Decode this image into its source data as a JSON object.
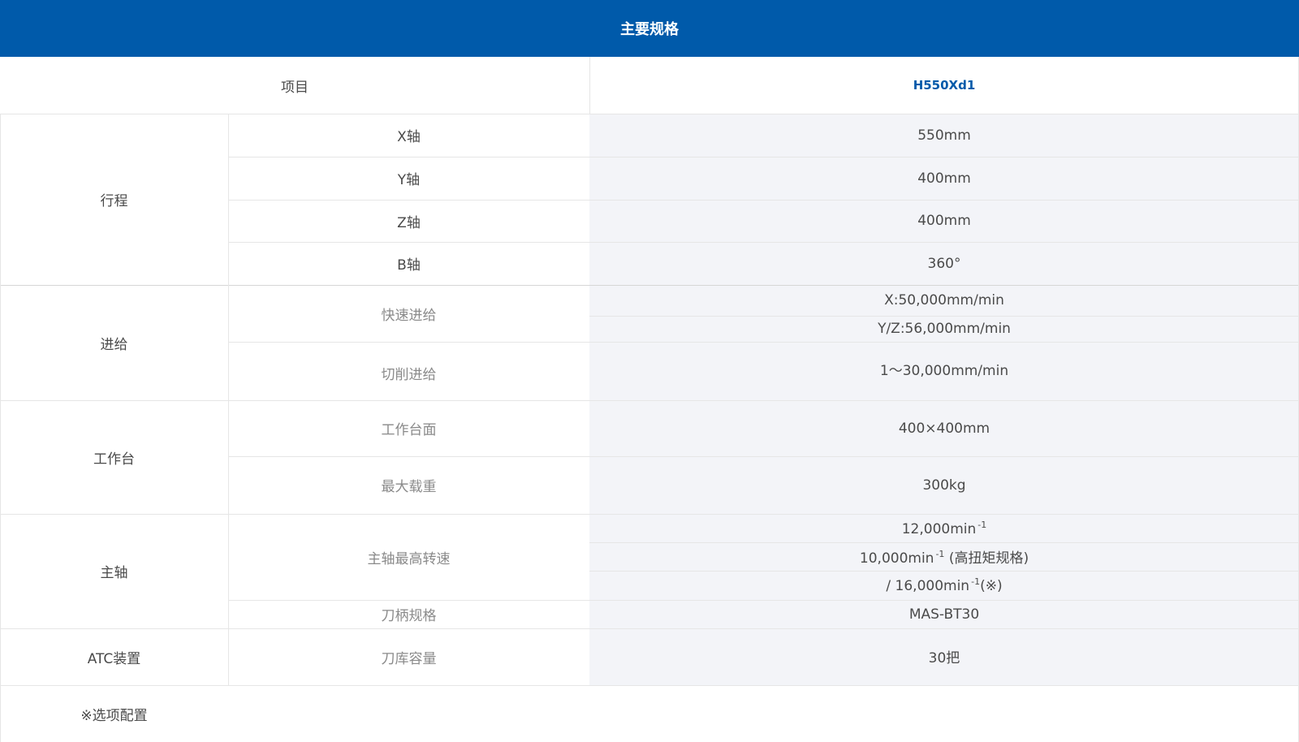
{
  "header": {
    "title": "主要规格"
  },
  "head_row": {
    "item_label": "项目",
    "model": "H550Xd1"
  },
  "travel": {
    "group": "行程",
    "rows": [
      {
        "label": "X轴",
        "value": "550mm"
      },
      {
        "label": "Y轴",
        "value": "400mm"
      },
      {
        "label": "Z轴",
        "value": "400mm"
      },
      {
        "label": "B轴",
        "value": "360°"
      }
    ]
  },
  "feed": {
    "group": "进给",
    "rapid_label": "快速进给",
    "rapid_values": [
      "X:50,000mm/min",
      "Y/Z:56,000mm/min"
    ],
    "cutting_label": "切削进给",
    "cutting_value": "1～30,000mm/min"
  },
  "table": {
    "group": "工作台",
    "surface_label": "工作台面",
    "surface_value": "400×400mm",
    "load_label": "最大载重",
    "load_value": "300kg"
  },
  "spindle": {
    "group": "主轴",
    "speed_label": "主轴最高转速",
    "speed_line1": "12,000min",
    "speed_line2_pre": "10,000min",
    "speed_line2_post": " (高扭矩规格)",
    "speed_line3_pre": "/ 16,000min",
    "speed_line3_post": "(※)",
    "exponent": "-1",
    "holder_label": "刀柄规格",
    "holder_value": "MAS-BT30"
  },
  "atc": {
    "group": "ATC装置",
    "capacity_label": "刀库容量",
    "capacity_value": "30把"
  },
  "footnote": "※选项配置"
}
